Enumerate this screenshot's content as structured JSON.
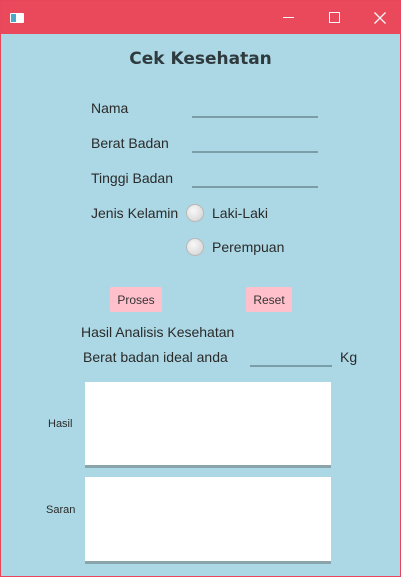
{
  "window": {
    "title": "Cek Kesehatan",
    "controls": {
      "minimize_icon": "minimize-icon",
      "maximize_icon": "maximize-icon",
      "close_icon": "close-icon"
    }
  },
  "form": {
    "nama_label": "Nama",
    "nama_value": "",
    "berat_label": "Berat Badan",
    "berat_value": "",
    "tinggi_label": "Tinggi Badan",
    "tinggi_value": "",
    "gender_label": "Jenis Kelamin",
    "gender_options": [
      "Laki-Laki",
      "Perempuan"
    ],
    "gender_selected": null
  },
  "actions": {
    "proses_label": "Proses",
    "reset_label": "Reset"
  },
  "result": {
    "section_title": "Hasil Analisis Kesehatan",
    "ideal_label": "Berat badan ideal anda",
    "ideal_value": "",
    "ideal_unit": "Kg",
    "hasil_label": "Hasil",
    "hasil_value": "",
    "saran_label": "Saran",
    "saran_value": ""
  },
  "colors": {
    "titlebar": "#e9495b",
    "window_bg": "#acd8e5",
    "button_bg": "#ffc0cc",
    "field_underline": "#7a9ea7"
  }
}
